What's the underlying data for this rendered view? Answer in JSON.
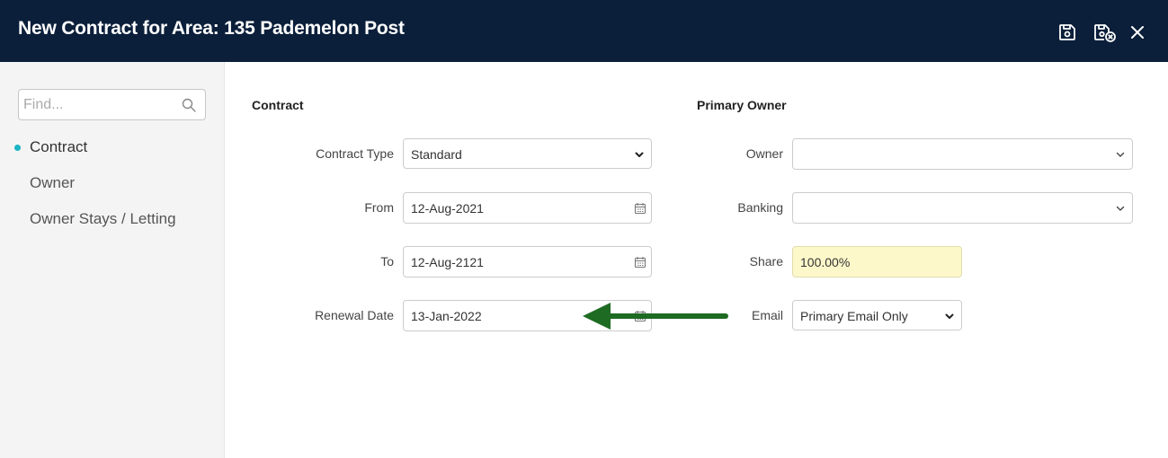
{
  "header": {
    "title": "New Contract for Area: 135 Pademelon Post",
    "colors": {
      "bg": "#0b1f3a",
      "text": "#ffffff"
    }
  },
  "sidebar": {
    "search": {
      "placeholder": "Find...",
      "value": ""
    },
    "items": [
      {
        "label": "Contract",
        "active": true
      },
      {
        "label": "Owner",
        "active": false
      },
      {
        "label": "Owner Stays / Letting",
        "active": false
      }
    ],
    "accent": "#1ab5c4"
  },
  "contract": {
    "title": "Contract",
    "contract_type": {
      "label": "Contract Type",
      "value": "Standard"
    },
    "from": {
      "label": "From",
      "value": "12-Aug-2021"
    },
    "to": {
      "label": "To",
      "value": "12-Aug-2121"
    },
    "renewal_date": {
      "label": "Renewal Date",
      "value": "13-Jan-2022"
    }
  },
  "primary_owner": {
    "title": "Primary Owner",
    "owner": {
      "label": "Owner",
      "value": ""
    },
    "banking": {
      "label": "Banking",
      "value": ""
    },
    "share": {
      "label": "Share",
      "value": "100.00%"
    },
    "email": {
      "label": "Email",
      "value": "Primary Email Only"
    }
  },
  "annotation": {
    "color": "#1e6b23",
    "icon": "arrow-left-icon"
  }
}
